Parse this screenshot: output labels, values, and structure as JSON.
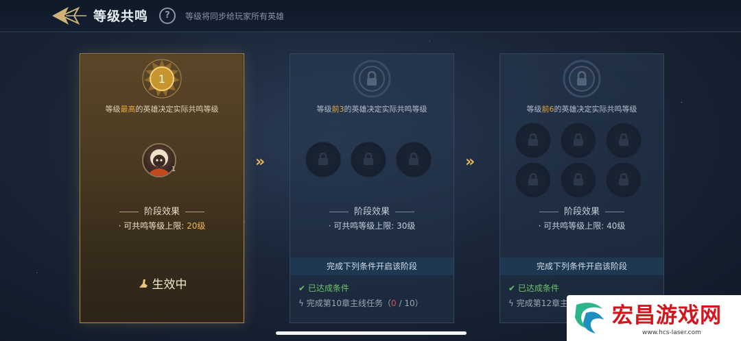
{
  "header": {
    "title": "等级共鸣",
    "help_symbol": "?",
    "subtitle": "等级将同步给玩家所有英雄"
  },
  "cards": [
    {
      "stage_number": "1",
      "req_prefix": "等级",
      "req_highlight": "最高",
      "req_suffix": "的英雄决定实际共鸣等级",
      "hero_level": "1",
      "section_title": "阶段效果",
      "limit_label": "· 可共鸣等级上限:",
      "limit_value": "20级",
      "status": "生效中"
    },
    {
      "req_prefix": "等级",
      "req_highlight": "前3",
      "req_suffix": "的英雄决定实际共鸣等级",
      "section_title": "阶段效果",
      "limit_label": "· 可共鸣等级上限:",
      "limit_value": "30级",
      "condition_header": "完成下列条件开启该阶段",
      "achieved_label": "已达成条件",
      "task_label": "完成第10章主线任务",
      "task_progress_current": "0",
      "task_progress_total": "10"
    },
    {
      "req_prefix": "等级",
      "req_highlight": "前6",
      "req_suffix": "的英雄决定实际共鸣等级",
      "section_title": "阶段效果",
      "limit_label": "· 可共鸣等级上限:",
      "limit_value": "40级",
      "condition_header": "完成下列条件开启该阶段",
      "achieved_label": "已达成条件",
      "task_label": "完成第12章主"
    }
  ],
  "arrows": "»",
  "watermark": {
    "text": "宏昌游戏网",
    "url": "www.hcs-laser.com"
  },
  "colors": {
    "accent_gold": "#e8a73a",
    "achieved_green": "#6cc46a",
    "progress_red": "#e24b4b",
    "watermark_red": "#d4161c"
  },
  "icons": [
    "back-arrow-icon",
    "help-icon",
    "stage-medal-icon",
    "lock-icon",
    "check-icon",
    "bolt-icon",
    "trophy-hand-icon",
    "fast-forward-icon"
  ]
}
